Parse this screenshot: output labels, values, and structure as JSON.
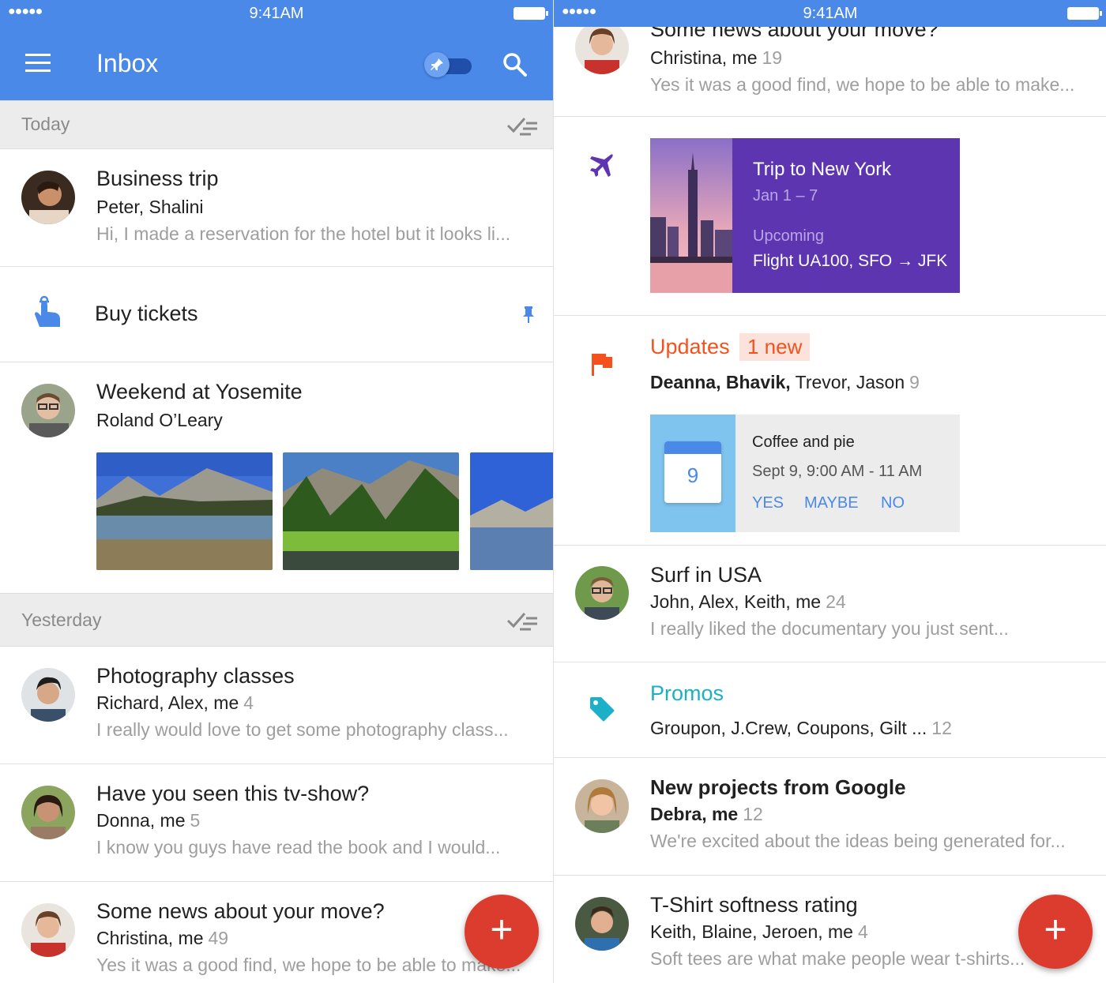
{
  "status_bar": {
    "signal": "●●●●●",
    "time": "9:41AM"
  },
  "app_bar": {
    "title": "Inbox"
  },
  "colors": {
    "primary": "#4a89e8",
    "fab": "#db3c2e",
    "trip": "#5e35b1",
    "updates": "#f4511e",
    "promos": "#1bb0c8",
    "reminder": "#4a89e8"
  },
  "left": {
    "sections": [
      {
        "label": "Today"
      },
      {
        "label": "Yesterday"
      }
    ],
    "business_trip": {
      "subject": "Business trip",
      "from": "Peter, Shalini",
      "snippet": "Hi, I made a reservation for the hotel but it looks li..."
    },
    "reminder": {
      "title": "Buy tickets",
      "icon": "finger-tied-string-icon"
    },
    "yosemite": {
      "subject": "Weekend at Yosemite",
      "from": "Roland O’Leary"
    },
    "photography": {
      "subject": "Photography classes",
      "from": "Richard, Alex, me",
      "count": "4",
      "snippet": "I really would love to get some photography class..."
    },
    "tvshow": {
      "subject": "Have you seen this tv-show?",
      "from": "Donna, me",
      "count": "5",
      "snippet": "I know you guys have read the book and I would..."
    },
    "move": {
      "subject": "Some news about your move?",
      "from": "Christina, me",
      "count": "49",
      "snippet": "Yes it was a good find, we hope to be able to make..."
    },
    "fab": "+"
  },
  "right": {
    "move": {
      "subject": "Some news about your move?",
      "from": "Christina, me",
      "count": "19",
      "snippet": "Yes it was a good find, we hope to be able to make..."
    },
    "trip": {
      "title": "Trip to New York",
      "dates": "Jan 1 – 7",
      "status": "Upcoming",
      "flight": "Flight UA100,  SFO → JFK"
    },
    "updates": {
      "label": "Updates",
      "badge": "1 new",
      "from_bold": "Deanna, Bhavik,",
      "from_rest": " Trevor, Jason",
      "count": "9",
      "event": {
        "day": "9",
        "title": "Coffee and pie",
        "time": "Sept 9, 9:00 AM - 11 AM",
        "yes": "YES",
        "maybe": "MAYBE",
        "no": "NO"
      }
    },
    "surf": {
      "subject": "Surf in USA",
      "from": "John, Alex, Keith, me",
      "count": "24",
      "snippet": "I really liked the documentary you just sent..."
    },
    "promos": {
      "label": "Promos",
      "from": "Groupon, J.Crew, Coupons, Gilt ...",
      "count": "12"
    },
    "google": {
      "subject": "New projects from Google",
      "from": "Debra, me",
      "count": "12",
      "snippet": "We're excited about the ideas being generated for..."
    },
    "tshirt": {
      "subject": "T-Shirt softness rating",
      "from": "Keith, Blaine, Jeroen, me",
      "count": "4",
      "snippet": "Soft tees are what make people wear t-shirts..."
    },
    "fab": "+"
  }
}
